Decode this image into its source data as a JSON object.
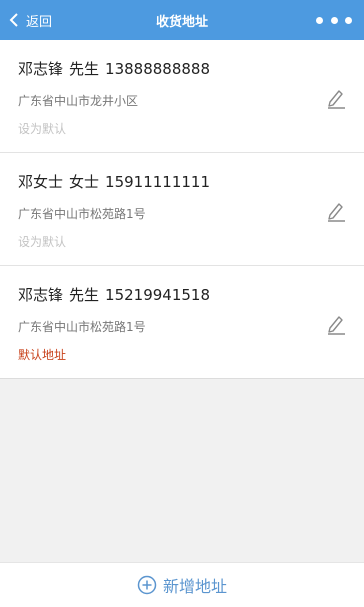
{
  "header": {
    "back_label": "返回",
    "title": "收货地址"
  },
  "addresses": [
    {
      "name": "邓志锋",
      "title": "先生",
      "phone": "13888888888",
      "address": "广东省中山市龙井小区",
      "default_text": "设为默认",
      "is_default": false
    },
    {
      "name": "邓女士",
      "title": "女士",
      "phone": "15911111111",
      "address": "广东省中山市松苑路1号",
      "default_text": "设为默认",
      "is_default": false
    },
    {
      "name": "邓志锋",
      "title": "先生",
      "phone": "15219941518",
      "address": "广东省中山市松苑路1号",
      "default_text": "默认地址",
      "is_default": true
    }
  ],
  "footer": {
    "add_label": "新增地址"
  },
  "colors": {
    "header_bg": "#4d9ae0",
    "default_red": "#c8411a",
    "link_blue": "#5b95cf"
  }
}
